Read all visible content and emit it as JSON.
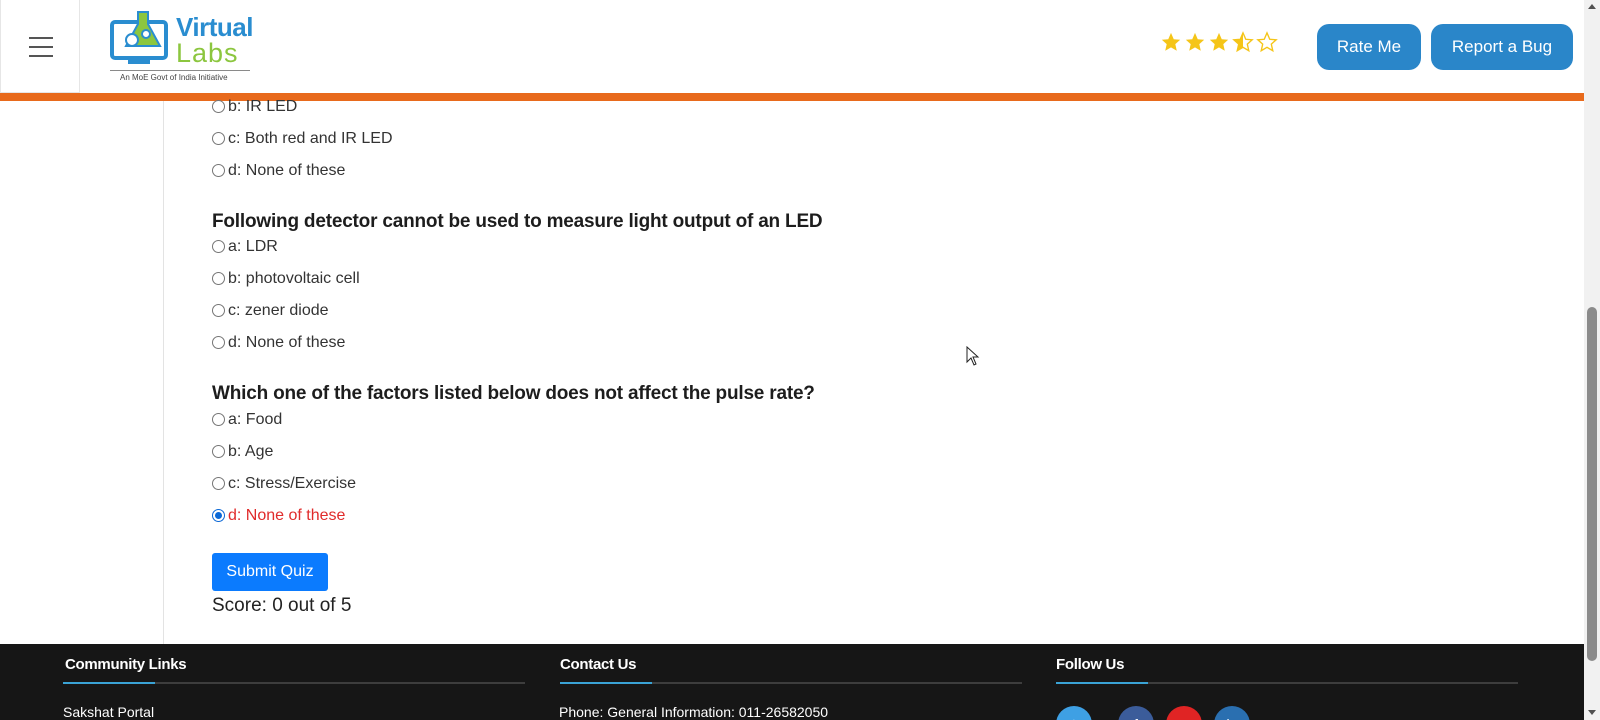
{
  "header": {
    "logo": {
      "virtual": "Virtual",
      "labs": "Labs",
      "tagline": "An MoE Govt of India Initiative"
    },
    "rating": {
      "value": 3.5,
      "max": 5,
      "star_color": "#f5c518"
    },
    "rate_label": "Rate Me",
    "bug_label": "Report a Bug",
    "accent_color": "#e86a1c",
    "button_color": "#2a86c9"
  },
  "quiz": {
    "prev_options": [
      {
        "label": "b: IR LED",
        "checked": false
      },
      {
        "label": "c: Both red and IR LED",
        "checked": false
      },
      {
        "label": "d: None of these",
        "checked": false
      }
    ],
    "questions": [
      {
        "text": "Following detector cannot be used to measure light output of an LED",
        "options": [
          {
            "label": "a: LDR",
            "checked": false
          },
          {
            "label": "b: photovoltaic cell",
            "checked": false
          },
          {
            "label": "c: zener diode",
            "checked": false
          },
          {
            "label": "d: None of these",
            "checked": false
          }
        ]
      },
      {
        "text": "Which one of the factors listed below does not affect the pulse rate?",
        "options": [
          {
            "label": "a: Food",
            "checked": false
          },
          {
            "label": "b: Age",
            "checked": false
          },
          {
            "label": "c: Stress/Exercise",
            "checked": false
          },
          {
            "label": "d: None of these",
            "checked": true,
            "state": "wrong"
          }
        ]
      }
    ],
    "submit_label": "Submit Quiz",
    "score_text": "Score: 0 out of 5",
    "wrong_color": "#e02b2b"
  },
  "footer": {
    "community": {
      "heading": "Community Links",
      "first_link": "Sakshat Portal"
    },
    "contact": {
      "heading": "Contact Us",
      "phone": "Phone: General Information: 011-26582050"
    },
    "follow": {
      "heading": "Follow Us",
      "icons": [
        "twitter-icon",
        "facebook-icon",
        "youtube-icon",
        "linkedin-icon"
      ]
    }
  }
}
